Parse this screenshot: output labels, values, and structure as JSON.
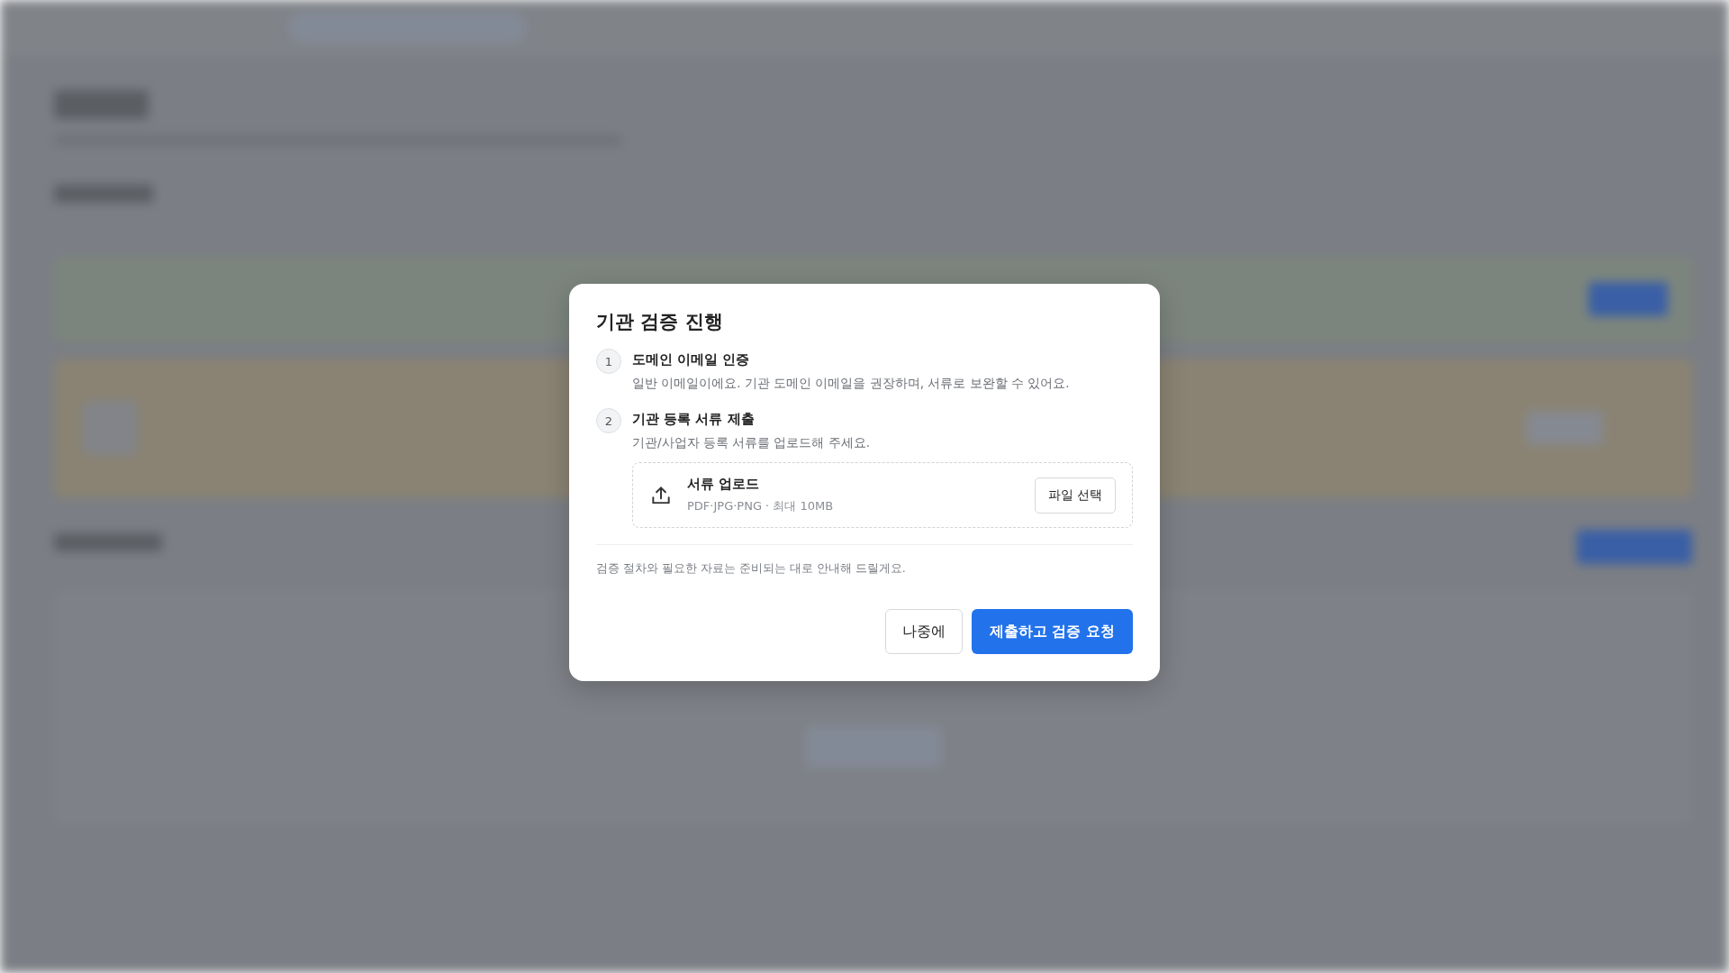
{
  "dialog": {
    "title": "기관 검증 진행",
    "steps": [
      {
        "number": "1",
        "title": "도메인 이메일 인증",
        "description": "일반 이메일이에요. 기관 도메인 이메일을 권장하며, 서류로 보완할 수 있어요."
      },
      {
        "number": "2",
        "title": "기관 등록 서류 제출",
        "description": "기관/사업자 등록 서류를 업로드해 주세요.",
        "upload": {
          "title": "서류 업로드",
          "hint": "PDF·JPG·PNG · 최대 10MB",
          "button": "파일 선택"
        }
      }
    ],
    "note": "검증 절차와 필요한 자료는 준비되는 대로 안내해 드릴게요.",
    "buttons": [
      {
        "label": "나중에",
        "kind": "secondary"
      },
      {
        "label": "제출하고 검증 요청",
        "kind": "primary"
      }
    ]
  }
}
